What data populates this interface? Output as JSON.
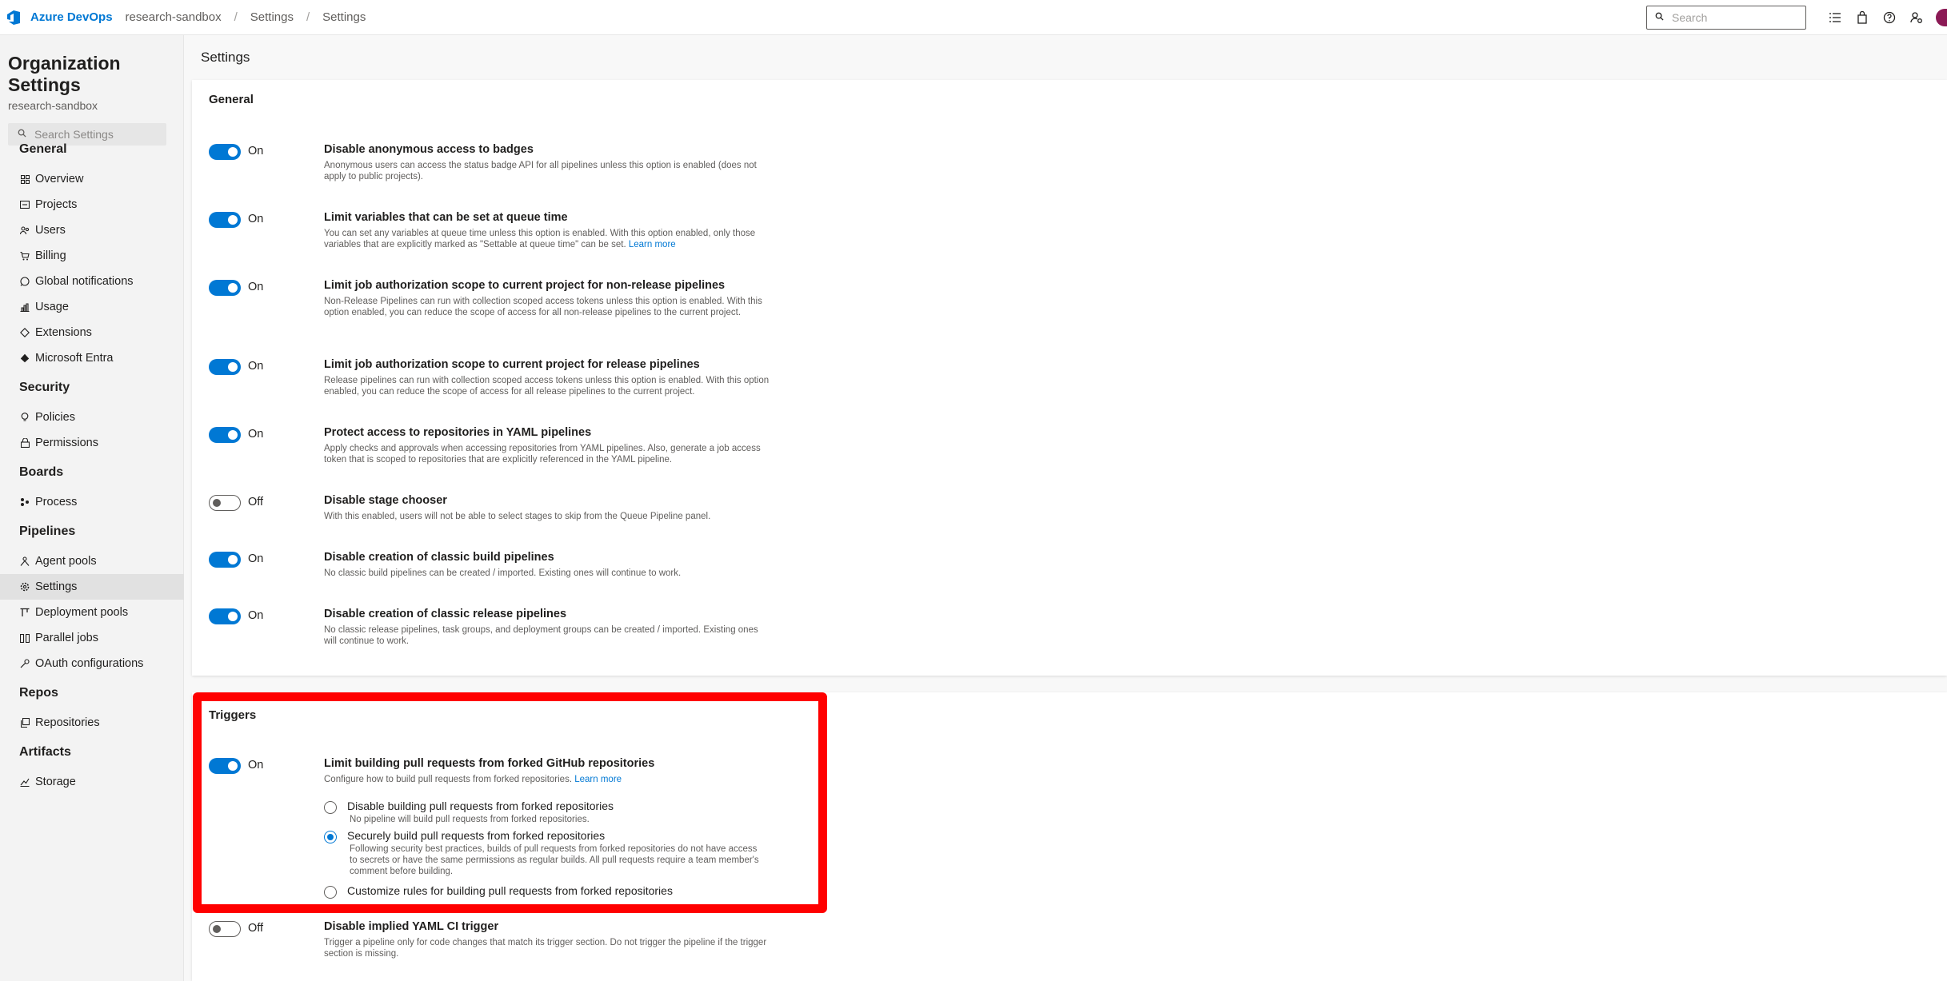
{
  "topbar": {
    "brand": "Azure DevOps",
    "breadcrumbs": [
      "research-sandbox",
      "Settings",
      "Settings"
    ],
    "separator": "/",
    "search_placeholder": "Search",
    "icons": [
      "task-list-icon",
      "shopping-bag-icon",
      "help-icon",
      "user-settings-icon"
    ]
  },
  "sidebar": {
    "title": "Organization Settings",
    "subtitle": "research-sandbox",
    "search_placeholder": "Search Settings",
    "sections": [
      {
        "heading": "General",
        "items": [
          {
            "label": "Overview",
            "icon": "overview-icon"
          },
          {
            "label": "Projects",
            "icon": "projects-icon"
          },
          {
            "label": "Users",
            "icon": "users-icon"
          },
          {
            "label": "Billing",
            "icon": "billing-icon"
          },
          {
            "label": "Global notifications",
            "icon": "notifications-icon"
          },
          {
            "label": "Usage",
            "icon": "usage-icon"
          },
          {
            "label": "Extensions",
            "icon": "extensions-icon"
          },
          {
            "label": "Microsoft Entra",
            "icon": "entra-icon"
          }
        ]
      },
      {
        "heading": "Security",
        "items": [
          {
            "label": "Policies",
            "icon": "policies-icon"
          },
          {
            "label": "Permissions",
            "icon": "permissions-icon"
          }
        ]
      },
      {
        "heading": "Boards",
        "items": [
          {
            "label": "Process",
            "icon": "process-icon"
          }
        ]
      },
      {
        "heading": "Pipelines",
        "items": [
          {
            "label": "Agent pools",
            "icon": "agent-pools-icon"
          },
          {
            "label": "Settings",
            "icon": "settings-gear-icon",
            "selected": true
          },
          {
            "label": "Deployment pools",
            "icon": "deployment-pools-icon"
          },
          {
            "label": "Parallel jobs",
            "icon": "parallel-jobs-icon"
          },
          {
            "label": "OAuth configurations",
            "icon": "oauth-icon"
          }
        ]
      },
      {
        "heading": "Repos",
        "items": [
          {
            "label": "Repositories",
            "icon": "repositories-icon"
          }
        ]
      },
      {
        "heading": "Artifacts",
        "items": [
          {
            "label": "Storage",
            "icon": "storage-icon"
          }
        ]
      }
    ]
  },
  "main": {
    "title": "Settings",
    "general": {
      "heading": "General",
      "settings": [
        {
          "state": "On",
          "title": "Disable anonymous access to badges",
          "desc": "Anonymous users can access the status badge API for all pipelines unless this option is enabled (does not apply to public projects)."
        },
        {
          "state": "On",
          "title": "Limit variables that can be set at queue time",
          "desc": "You can set any variables at queue time unless this option is enabled. With this option enabled, only those variables that are explicitly marked as \"Settable at queue time\" can be set.",
          "link": "Learn more"
        },
        {
          "state": "On",
          "title": "Limit job authorization scope to current project for non-release pipelines",
          "desc": "Non-Release Pipelines can run with collection scoped access tokens unless this option is enabled. With this option enabled, you can reduce the scope of access for all non-release pipelines to the current project."
        },
        {
          "state": "On",
          "title": "Limit job authorization scope to current project for release pipelines",
          "desc": "Release pipelines can run with collection scoped access tokens unless this option is enabled. With this option enabled, you can reduce the scope of access for all release pipelines to the current project."
        },
        {
          "state": "On",
          "title": "Protect access to repositories in YAML pipelines",
          "desc": "Apply checks and approvals when accessing repositories from YAML pipelines. Also, generate a job access token that is scoped to repositories that are explicitly referenced in the YAML pipeline."
        },
        {
          "state": "Off",
          "title": "Disable stage chooser",
          "desc": "With this enabled, users will not be able to select stages to skip from the Queue Pipeline panel."
        },
        {
          "state": "On",
          "title": "Disable creation of classic build pipelines",
          "desc": "No classic build pipelines can be created / imported. Existing ones will continue to work."
        },
        {
          "state": "On",
          "title": "Disable creation of classic release pipelines",
          "desc": "No classic release pipelines, task groups, and deployment groups can be created / imported. Existing ones will continue to work."
        }
      ]
    },
    "triggers": {
      "heading": "Triggers",
      "fork_setting": {
        "state": "On",
        "title": "Limit building pull requests from forked GitHub repositories",
        "desc": "Configure how to build pull requests from forked repositories.",
        "link": "Learn more",
        "options": [
          {
            "label": "Disable building pull requests from forked repositories",
            "desc": "No pipeline will build pull requests from forked repositories.",
            "checked": false
          },
          {
            "label": "Securely build pull requests from forked repositories",
            "desc": "Following security best practices, builds of pull requests from forked repositories do not have access to secrets or have the same permissions as regular builds. All pull requests require a team member's comment before building.",
            "checked": true
          },
          {
            "label": "Customize rules for building pull requests from forked repositories",
            "desc": "",
            "checked": false
          }
        ]
      },
      "yaml_ci": {
        "state": "Off",
        "title": "Disable implied YAML CI trigger",
        "desc": "Trigger a pipeline only for code changes that match its trigger section. Do not trigger the pipeline if the trigger section is missing."
      }
    }
  },
  "colors": {
    "accent": "#0078d4",
    "highlight": "#ff0000",
    "avatar": "#8b1a55"
  }
}
